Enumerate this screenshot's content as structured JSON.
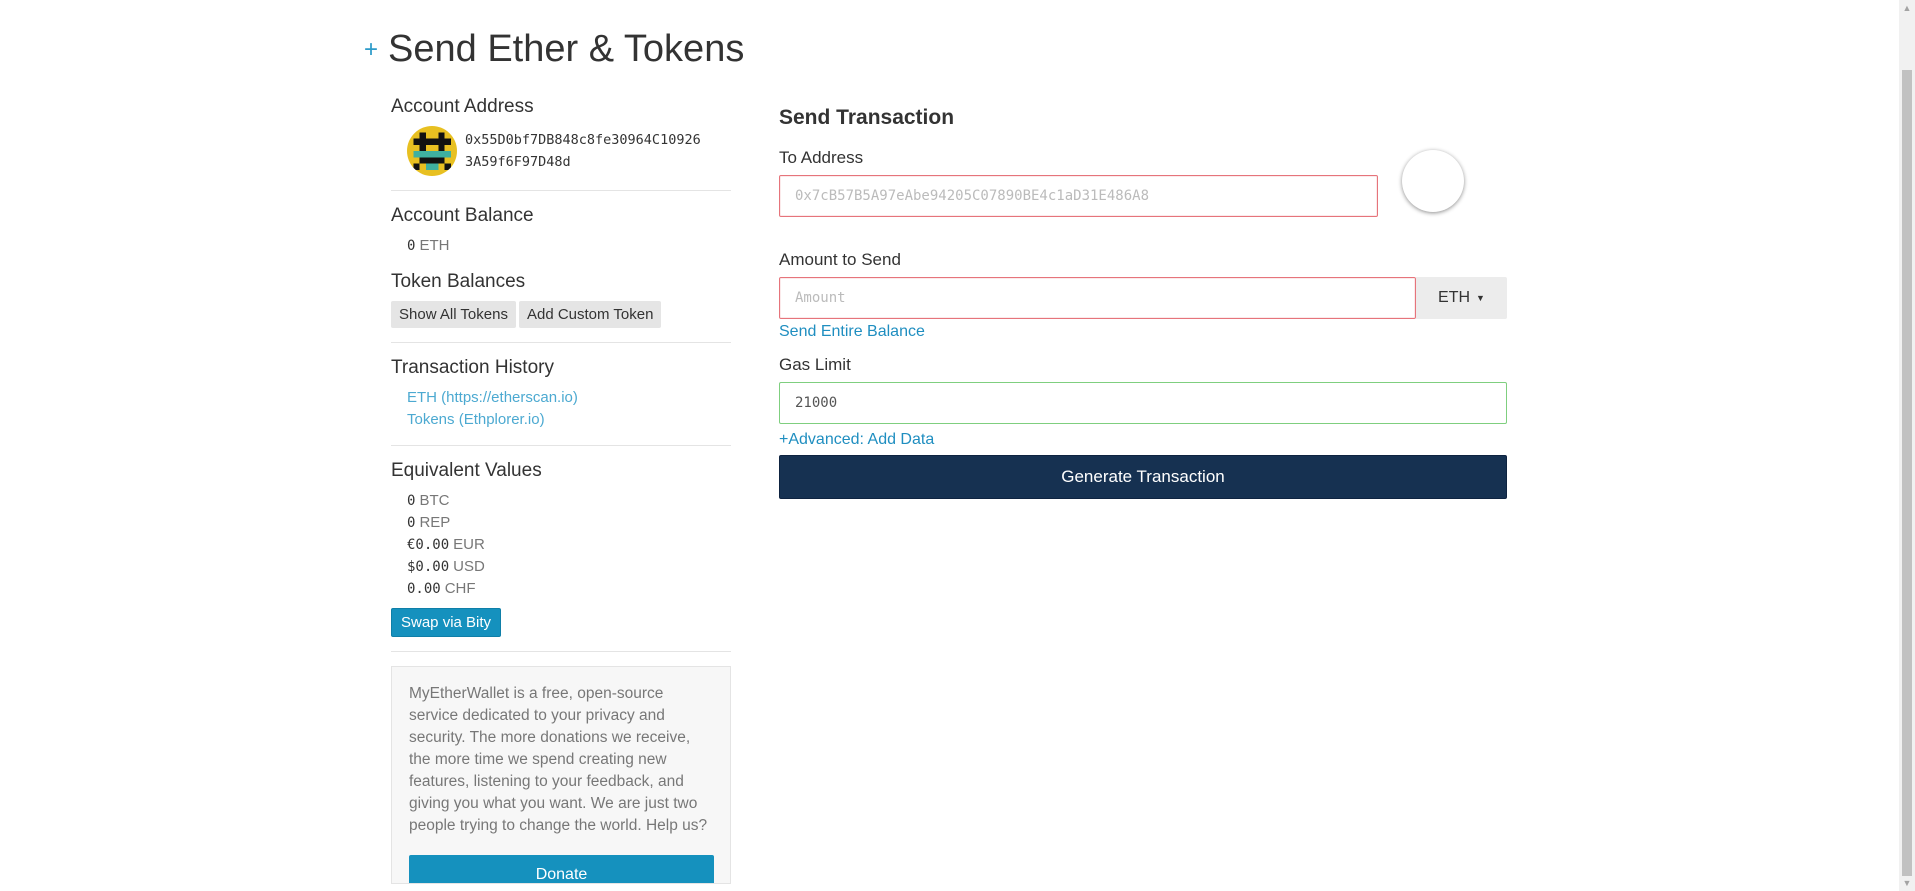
{
  "page": {
    "title": "Send Ether & Tokens"
  },
  "sidebar": {
    "account_address_label": "Account Address",
    "address_line1": "0x55D0bf7DB848c8fe30964C10926",
    "address_line2": "3A59f6F97D48d",
    "account_balance_label": "Account Balance",
    "balance_value": "0",
    "balance_unit": "ETH",
    "token_balances_label": "Token Balances",
    "show_all_tokens": "Show All Tokens",
    "add_custom_token": "Add Custom Token",
    "tx_history_label": "Transaction History",
    "tx_history_links": [
      "ETH (https://etherscan.io)",
      "Tokens (Ethplorer.io)"
    ],
    "equivalent_values_label": "Equivalent Values",
    "equivalents": [
      {
        "value": "0",
        "unit": "BTC"
      },
      {
        "value": "0",
        "unit": "REP"
      },
      {
        "value": "€0.00",
        "unit": "EUR"
      },
      {
        "value": "$0.00",
        "unit": "USD"
      },
      {
        "value": "0.00",
        "unit": "CHF"
      }
    ],
    "swap_button": "Swap via Bity",
    "donate_text": "MyEtherWallet is a free, open-source service dedicated to your privacy and security. The more donations we receive, the more time we spend creating new features, listening to your feedback, and giving you what you want. We are just two people trying to change the world. Help us?",
    "donate_button": "Donate"
  },
  "form": {
    "title": "Send Transaction",
    "to_label": "To Address",
    "to_placeholder": "0x7cB57B5A97eAbe94205C07890BE4c1aD31E486A8",
    "amount_label": "Amount to Send",
    "amount_placeholder": "Amount",
    "currency": "ETH",
    "send_entire_balance": "Send Entire Balance",
    "gas_label": "Gas Limit",
    "gas_value": "21000",
    "advanced_link": "+Advanced: Add Data",
    "generate_button": "Generate Transaction"
  },
  "colors": {
    "accent": "#2d9bc9",
    "primary_dark": "#163151",
    "invalid_border": "#e6747b",
    "valid_border": "#7fcf7f"
  }
}
